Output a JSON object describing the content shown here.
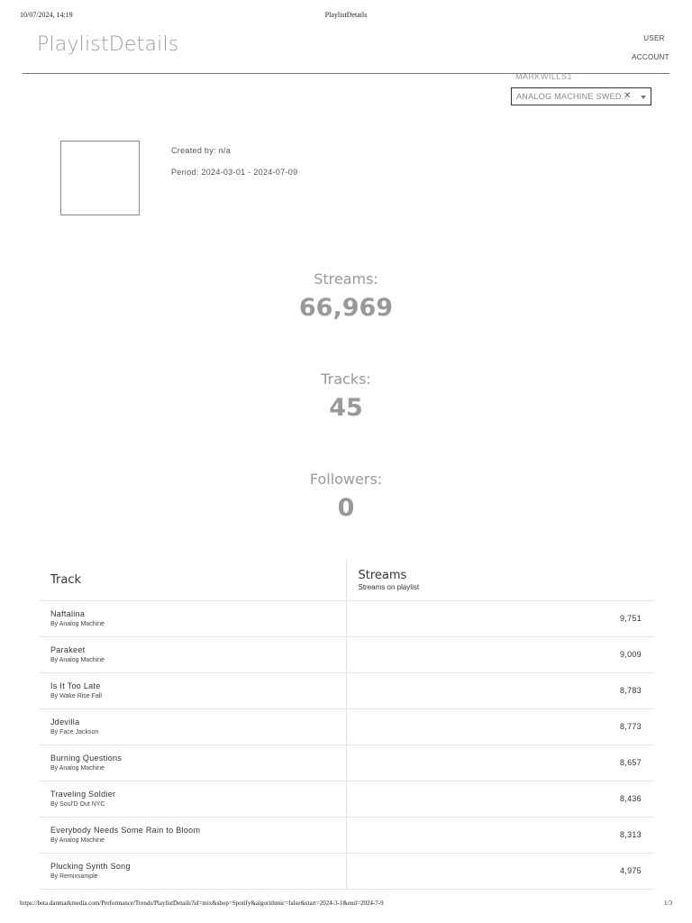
{
  "print_header": {
    "datetime": "10/07/2024, 14:19",
    "title": "PlaylistDetails"
  },
  "header": {
    "app_title": "PlaylistDetails",
    "nav_user": "USER",
    "nav_account": "ACCOUNT",
    "username": "MARKWILLS1",
    "selector": {
      "selected_value": "ANALOG MACHINE SWED...",
      "clear_icon": "close-icon",
      "caret_icon": "chevron-down-icon"
    }
  },
  "playlist": {
    "created_by": "Created by: n/a",
    "period": "Period: 2024-03-01 - 2024-07-09"
  },
  "stats": {
    "streams_label": "Streams:",
    "streams_value": "66,969",
    "tracks_label": "Tracks:",
    "tracks_value": "45",
    "followers_label": "Followers:",
    "followers_value": "0"
  },
  "table": {
    "col_track": "Track",
    "col_streams": "Streams",
    "col_streams_sub": "Streams on playlist",
    "rows": [
      {
        "track": "Naftalina",
        "artist": "By Analog Machine",
        "streams": "9,751"
      },
      {
        "track": "Parakeet",
        "artist": "By Analog Machine",
        "streams": "9,009"
      },
      {
        "track": "Is It Too Late",
        "artist": "By Wake Rise Fall",
        "streams": "8,783"
      },
      {
        "track": "Jdevilla",
        "artist": "By Face Jackson",
        "streams": "8,773"
      },
      {
        "track": "Burning Questions",
        "artist": "By Analog Machine",
        "streams": "8,657"
      },
      {
        "track": "Traveling Soldier",
        "artist": "By Soul'D Out NYC",
        "streams": "8,436"
      },
      {
        "track": "Everybody Needs Some Rain to Bloom",
        "artist": "By Analog Machine",
        "streams": "8,313"
      },
      {
        "track": "Plucking Synth Song",
        "artist": "By Remixsample",
        "streams": "4,975"
      }
    ]
  },
  "print_footer": {
    "url": "https://beta.danmarkmedia.com/Performance/Trends/PlaylistDetails?id=mix&shop=Spotify&algorithmic=false&start=2024-3-1&end=2024-7-9",
    "page": "1/3"
  }
}
